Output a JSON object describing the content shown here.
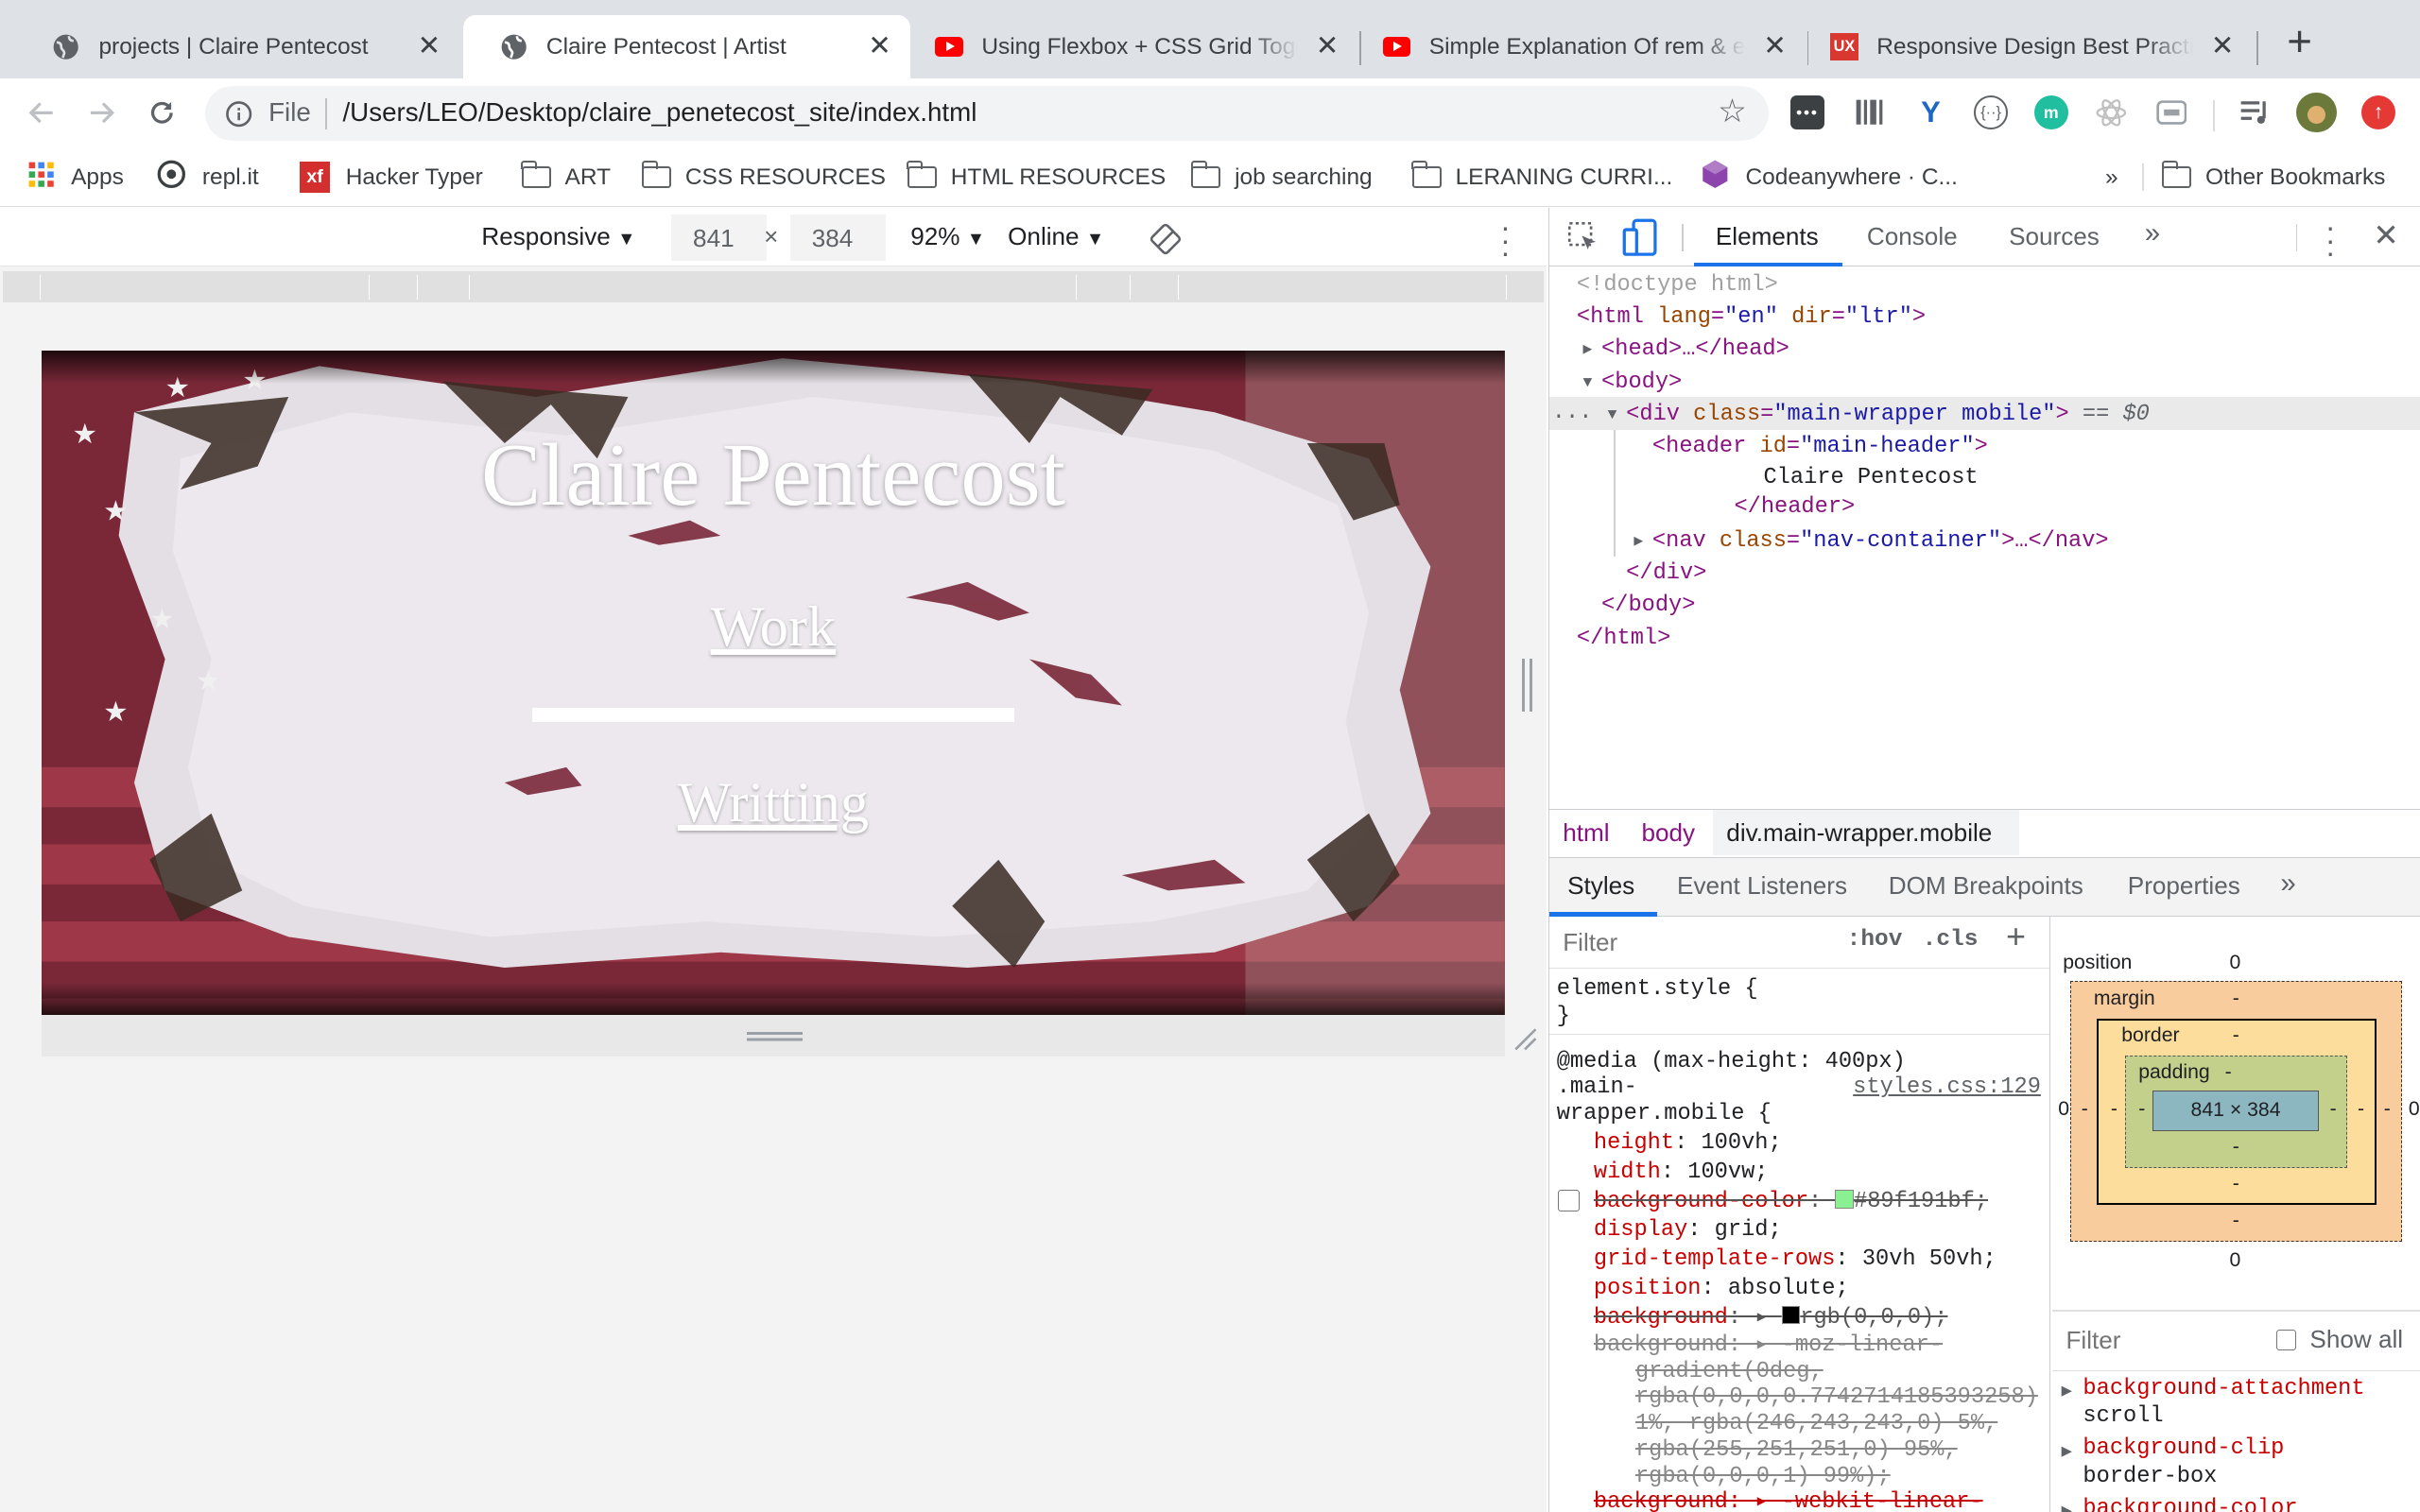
{
  "tabs": [
    {
      "title": "projects | Claire Pentecost",
      "icon": "globe-icon",
      "active": false
    },
    {
      "title": "Claire Pentecost | Artist",
      "icon": "globe-icon",
      "active": true
    },
    {
      "title": "Using Flexbox + CSS Grid Together",
      "icon": "youtube-icon",
      "active": false
    },
    {
      "title": "Simple Explanation Of rem & em",
      "icon": "youtube-icon",
      "active": false
    },
    {
      "title": "Responsive Design Best Practices",
      "icon": "ux-icon",
      "active": false
    }
  ],
  "omnibox": {
    "scheme": "File",
    "url": "/Users/LEO/Desktop/claire_penetecost_site/index.html"
  },
  "bookmarks": [
    {
      "label": "Apps"
    },
    {
      "label": "repl.it"
    },
    {
      "label": "Hacker Typer"
    },
    {
      "label": "ART"
    },
    {
      "label": "CSS RESOURCES"
    },
    {
      "label": "HTML RESOURCES"
    },
    {
      "label": "job searching"
    },
    {
      "label": "LERANING CURRI..."
    },
    {
      "label": "Codeanywhere · C..."
    }
  ],
  "bookmarks_overflow": "»",
  "other_bookmarks": "Other Bookmarks",
  "device_toolbar": {
    "mode": "Responsive",
    "width": "841",
    "times": "×",
    "height": "384",
    "zoom": "92%",
    "network": "Online"
  },
  "page": {
    "title": "Claire Pentecost",
    "links": [
      "Work",
      "Writting"
    ]
  },
  "devtools": {
    "tabs": [
      "Elements",
      "Console",
      "Sources"
    ],
    "more": "»",
    "dom": {
      "doctype": "<!doctype html>",
      "html_open": "<html",
      "attr_lang": "lang",
      "val_lang": "\"en\"",
      "attr_dir": "dir",
      "val_dir": "\"ltr\"",
      "head": "<head>…</head>",
      "body_open": "<body>",
      "div_open": "<div",
      "attr_class": "class",
      "val_div_class": "\"main-wrapper mobile\"",
      "selected_marker": "== $0",
      "header_open": "<header",
      "attr_id": "id",
      "val_header_id": "\"main-header\"",
      "header_text": "Claire Pentecost",
      "header_close": "</header>",
      "nav_open": "<nav",
      "val_nav_class": "\"nav-container\"",
      "nav_rest": ">…</nav>",
      "div_close": "</div>",
      "body_close": "</body>",
      "html_close": "</html>",
      "ellipsis": "..."
    },
    "breadcrumbs": [
      "html",
      "body",
      "div.main-wrapper.mobile"
    ],
    "style_tabs": [
      "Styles",
      "Event Listeners",
      "DOM Breakpoints",
      "Properties"
    ],
    "filter_placeholder": "Filter",
    "hov": ":hov",
    "cls": ".cls",
    "element_style": "element.style {",
    "brace_close": "}",
    "media": "@media (max-height: 400px)",
    "selector_1": ".main-",
    "selector_2": "wrapper.mobile {",
    "source": "styles.css:129",
    "rules": [
      {
        "prop": "height",
        "value": "100vh;",
        "struck": false
      },
      {
        "prop": "width",
        "value": "100vw;",
        "struck": false
      },
      {
        "prop": "background-color",
        "value": "#89f191bf;",
        "struck": true,
        "swatch": "#89f191"
      },
      {
        "prop": "display",
        "value": "grid;",
        "struck": false
      },
      {
        "prop": "grid-template-rows",
        "value": "30vh 50vh;",
        "struck": false
      },
      {
        "prop": "position",
        "value": "absolute;",
        "struck": false
      },
      {
        "prop": "background",
        "value": "rgb(0,0,0);",
        "struck": true,
        "swatch": "#000000"
      }
    ],
    "gradient_lines": [
      "background: ▸ -moz-linear-",
      "gradient(0deg,",
      "rgba(0,0,0,0.7742714185393258)",
      "1%, rgba(246,243,243,0) 5%,",
      "rgba(255,251,251,0) 95%,",
      "rgba(0,0,0,1) 99%);",
      "background: ▸ -webkit-linear-"
    ],
    "box_model": {
      "position_label": "position",
      "position_value": "0",
      "margin_label": "margin",
      "border_label": "border",
      "padding_label": "padding",
      "dash": "-",
      "content": "841 × 384",
      "zero": "0"
    },
    "computed": {
      "filter_placeholder": "Filter",
      "show_all": "Show all",
      "items": [
        {
          "prop": "background-attachment",
          "value": "scroll"
        },
        {
          "prop": "background-clip",
          "value": "border-box"
        },
        {
          "prop": "background-color",
          "value": ""
        }
      ]
    }
  },
  "colors": {
    "accent": "#1a73e8",
    "tabstrip": "#dee1e6",
    "devtools_prop": "#c80000",
    "tag": "#881280"
  }
}
